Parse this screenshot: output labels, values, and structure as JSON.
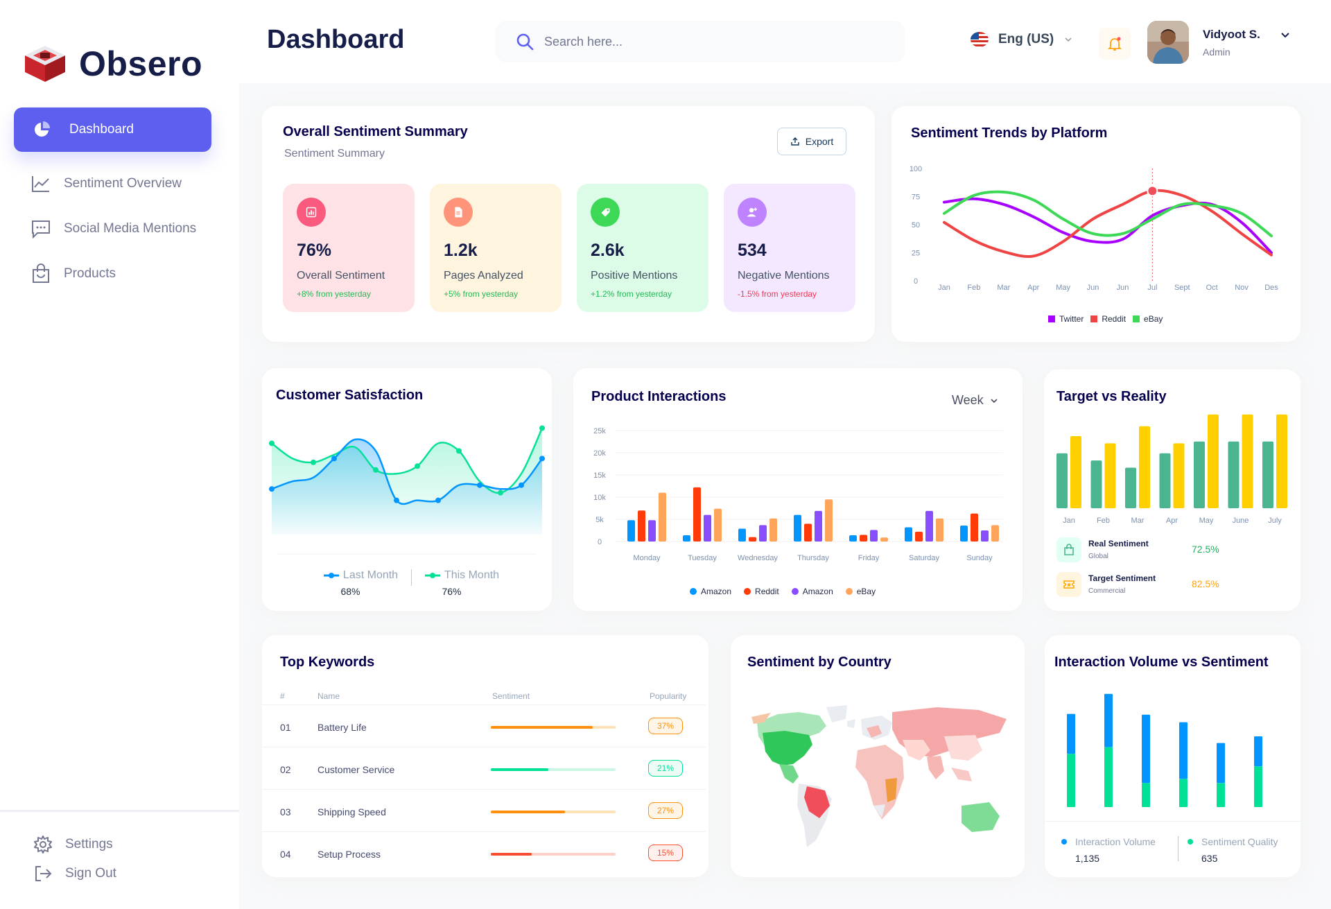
{
  "app": {
    "name": "Obsero"
  },
  "sidebar": {
    "items": [
      {
        "label": "Dashboard",
        "icon": "pie-chart-icon",
        "active": true
      },
      {
        "label": "Sentiment Overview",
        "icon": "line-chart-icon"
      },
      {
        "label": "Social Media Mentions",
        "icon": "chat-icon"
      },
      {
        "label": "Products",
        "icon": "shopping-bag-icon"
      }
    ],
    "bottom": [
      {
        "label": "Settings",
        "icon": "gear-icon"
      },
      {
        "label": "Sign Out",
        "icon": "sign-out-icon"
      }
    ],
    "accent": "#5D5FEF"
  },
  "header": {
    "title": "Dashboard",
    "search_placeholder": "Search here...",
    "language": "Eng (US)",
    "user": {
      "name": "Vidyoot S.",
      "role": "Admin"
    }
  },
  "summary": {
    "title": "Overall Sentiment Summary",
    "subtitle": "Sentiment Summary",
    "export_label": "Export",
    "kpis": [
      {
        "value": "76%",
        "label": "Overall Sentiment",
        "delta": "+8% from yesterday",
        "bg": "#FFE2E5",
        "icon_bg": "#FA5A7D",
        "delta_color": "#25B856"
      },
      {
        "value": "1.2k",
        "label": "Pages Analyzed",
        "delta": "+5% from yesterday",
        "bg": "#FFF4DE",
        "icon_bg": "#FF947A",
        "delta_color": "#25B856"
      },
      {
        "value": "2.6k",
        "label": "Positive Mentions",
        "delta": "+1.2% from yesterday",
        "bg": "#DCFCE7",
        "icon_bg": "#3CD856",
        "delta_color": "#25B856"
      },
      {
        "value": "534",
        "label": "Negative Mentions",
        "delta": "-1.5% from yesterday",
        "bg": "#F3E8FF",
        "icon_bg": "#BF83FF",
        "delta_color": "#F0384F"
      }
    ]
  },
  "trends": {
    "title": "Sentiment Trends by Platform",
    "legend": [
      "Twitter",
      "Reddit",
      "eBay"
    ],
    "colors": [
      "#A700FF",
      "#EF4444",
      "#3CD856"
    ]
  },
  "satisfaction": {
    "title": "Customer Satisfaction",
    "legend": [
      {
        "label": "Last Month",
        "value": "68%",
        "color": "#0095FF"
      },
      {
        "label": "This Month",
        "value": "76%",
        "color": "#07E098"
      }
    ]
  },
  "interactions": {
    "title": "Product Interactions",
    "period": "Week",
    "legend": [
      {
        "label": "Amazon",
        "color": "#0095FF"
      },
      {
        "label": "Reddit",
        "color": "#FF3B0A"
      },
      {
        "label": "Amazon",
        "color": "#884DFF"
      },
      {
        "label": "eBay",
        "color": "#FFA45B"
      }
    ]
  },
  "target": {
    "title": "Target vs Reality",
    "stats": [
      {
        "label": "Real Sentiment",
        "sub": "Global",
        "value": "72.5%",
        "color": "#27AE60",
        "icon": "bag-icon"
      },
      {
        "label": "Target Sentiment",
        "sub": "Commercial",
        "value": "82.5%",
        "color": "#FFA412",
        "icon": "ticket-icon"
      }
    ]
  },
  "keywords": {
    "title": "Top Keywords",
    "columns": [
      "#",
      "Name",
      "Sentiment",
      "Popularity"
    ],
    "rows": [
      {
        "num": "01",
        "name": "Battery Life",
        "pct": "37%",
        "color": "#FF8F0D",
        "bg": "#FFE2B5"
      },
      {
        "num": "02",
        "name": "Customer Service",
        "pct": "21%",
        "color": "#00E096",
        "bg": "#CCF6E4"
      },
      {
        "num": "03",
        "name": "Shipping Speed",
        "pct": "27%",
        "color": "#FF8F0D",
        "bg": "#FFE2B5"
      },
      {
        "num": "04",
        "name": "Setup Process",
        "pct": "15%",
        "color": "#F64E2F",
        "bg": "#FFCFC9"
      }
    ]
  },
  "country": {
    "title": "Sentiment by Country"
  },
  "volume": {
    "title": "Interaction Volume vs Sentiment",
    "legend": [
      {
        "label": "Interaction Volume",
        "value": "1,135",
        "color": "#0095FF"
      },
      {
        "label": "Sentiment Quality",
        "value": "635",
        "color": "#00E096"
      }
    ]
  },
  "chart_data": [
    {
      "type": "line",
      "title": "Sentiment Trends by Platform",
      "x": [
        "Jan",
        "Feb",
        "Mar",
        "Apr",
        "May",
        "Jun",
        "Jun",
        "Jul",
        "Sept",
        "Oct",
        "Nov",
        "Des"
      ],
      "ylim": [
        0,
        100
      ],
      "yticks": [
        0,
        25,
        50,
        75,
        100
      ],
      "series": [
        {
          "name": "Twitter",
          "values": [
            70,
            73,
            68,
            57,
            43,
            35,
            37,
            58,
            67,
            68,
            52,
            25
          ]
        },
        {
          "name": "Reddit",
          "values": [
            52,
            36,
            26,
            22,
            35,
            55,
            68,
            80,
            76,
            62,
            42,
            23
          ]
        },
        {
          "name": "eBay",
          "values": [
            60,
            76,
            79,
            72,
            55,
            42,
            42,
            55,
            68,
            67,
            60,
            40
          ]
        }
      ]
    },
    {
      "type": "area",
      "title": "Customer Satisfaction",
      "series": [
        {
          "name": "Last Month",
          "values": [
            2.4,
            2.6,
            2.7,
            3.2,
            3.7,
            3.4,
            2.1,
            2.1,
            2.1,
            2.5,
            2.5,
            2.4,
            2.5,
            3.2
          ]
        },
        {
          "name": "This Month",
          "values": [
            3.6,
            3.2,
            3.1,
            3.3,
            3.5,
            2.9,
            2.8,
            3.0,
            3.6,
            3.4,
            2.6,
            2.3,
            2.8,
            4.0
          ]
        }
      ]
    },
    {
      "type": "bar",
      "title": "Product Interactions",
      "categories": [
        "Monday",
        "Tuesday",
        "Wednesday",
        "Thursday",
        "Friday",
        "Saturday",
        "Sunday"
      ],
      "ylim": [
        0,
        25000
      ],
      "yticks": [
        "0",
        "5k",
        "10k",
        "15k",
        "20k",
        "25k"
      ],
      "series": [
        {
          "name": "Amazon",
          "values": [
            4800,
            1400,
            2900,
            6000,
            1400,
            3200,
            3600
          ]
        },
        {
          "name": "Reddit",
          "values": [
            7000,
            12200,
            1000,
            4000,
            1500,
            2200,
            6300
          ]
        },
        {
          "name": "Amazon",
          "values": [
            4800,
            6000,
            3700,
            6900,
            2600,
            6900,
            2500
          ]
        },
        {
          "name": "eBay",
          "values": [
            11000,
            7400,
            5200,
            9500,
            900,
            5200,
            3700
          ]
        }
      ]
    },
    {
      "type": "bar",
      "title": "Target vs Reality",
      "categories": [
        "Jan",
        "Feb",
        "Mar",
        "Apr",
        "May",
        "June",
        "July"
      ],
      "series": [
        {
          "name": "Real Sentiment",
          "values": [
            61,
            53,
            45,
            61,
            74,
            74,
            74
          ]
        },
        {
          "name": "Target Sentiment",
          "values": [
            80,
            72,
            91,
            72,
            104,
            104,
            104
          ]
        }
      ]
    },
    {
      "type": "bar",
      "title": "Interaction Volume vs Sentiment",
      "categories": [
        "1",
        "2",
        "3",
        "4",
        "5",
        "6"
      ],
      "series": [
        {
          "name": "Interaction Volume",
          "values": [
            48,
            64,
            82,
            68,
            48,
            36
          ]
        },
        {
          "name": "Sentiment Quality",
          "values": [
            64,
            72,
            29,
            34,
            29,
            49
          ]
        }
      ]
    }
  ]
}
